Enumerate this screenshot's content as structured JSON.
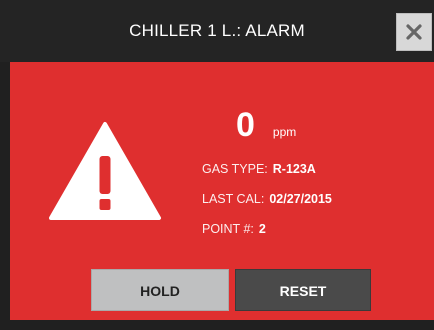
{
  "dialog": {
    "title": "CHILLER 1 L.: ALARM",
    "close_icon": "close-icon"
  },
  "alarm": {
    "icon": "warning-icon",
    "value": "0",
    "unit": "ppm",
    "gas_type_label": "GAS TYPE:",
    "gas_type_value": "R-123A",
    "last_cal_label": "LAST CAL:",
    "last_cal_value": "02/27/2015",
    "point_label": "POINT #:",
    "point_value": "2"
  },
  "buttons": {
    "hold_label": "HOLD",
    "reset_label": "RESET"
  },
  "colors": {
    "alarm_background": "#df2f2f",
    "titlebar": "#242424",
    "hold_button": "#bfc0c1",
    "reset_button": "#4a4a4a"
  }
}
